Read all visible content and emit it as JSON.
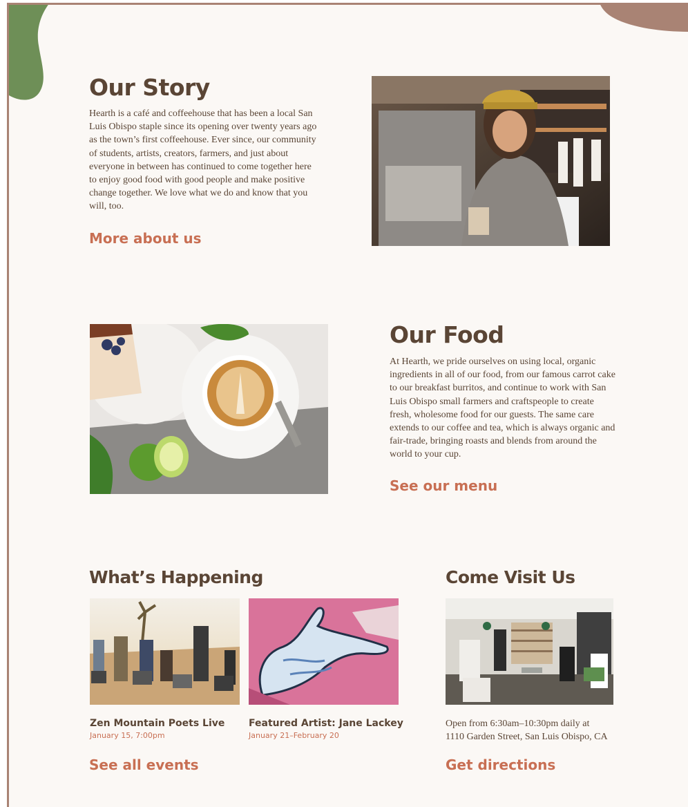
{
  "colors": {
    "heading": "#5a4535",
    "accent": "#c86f53",
    "blob_green": "#6e8f57",
    "blob_brown": "#a98374",
    "background": "#fbf8f5"
  },
  "story": {
    "title": "Our Story",
    "body": "Hearth is a café and coffeehouse that has been a local San Luis Obispo staple since its opening over twenty years ago as the town’s first coffeehouse. Ever since, our community of students, artists, creators, farmers, and just about everyone in between has continued to come together here to enjoy good food with good people and make positive change together. We love what we do and know that you will, too.",
    "link": "More about us"
  },
  "food": {
    "title": "Our Food",
    "body": "At Hearth, we pride ourselves on using local, organic ingredients in all of our food, from our famous carrot cake to our breakfast burritos, and continue to work with San Luis Obispo small farmers and craftspeople to create fresh, wholesome food for our guests. The same care extends to our coffee and tea, which is always organic and fair-trade, bringing roasts and blends from around the world to your cup.",
    "link": "See our menu"
  },
  "happening": {
    "title": "What’s Happening",
    "events": [
      {
        "title": "Zen Mountain Poets Live",
        "date": "January 15, 7:00pm"
      },
      {
        "title": "Featured Artist: Jane Lackey",
        "date": "January 21–February 20"
      }
    ],
    "link": "See all events"
  },
  "visit": {
    "title": "Come Visit Us",
    "hours": "Open from 6:30am–10:30pm daily at",
    "address": "1110 Garden Street, San Luis Obispo, CA",
    "link": "Get directions"
  }
}
